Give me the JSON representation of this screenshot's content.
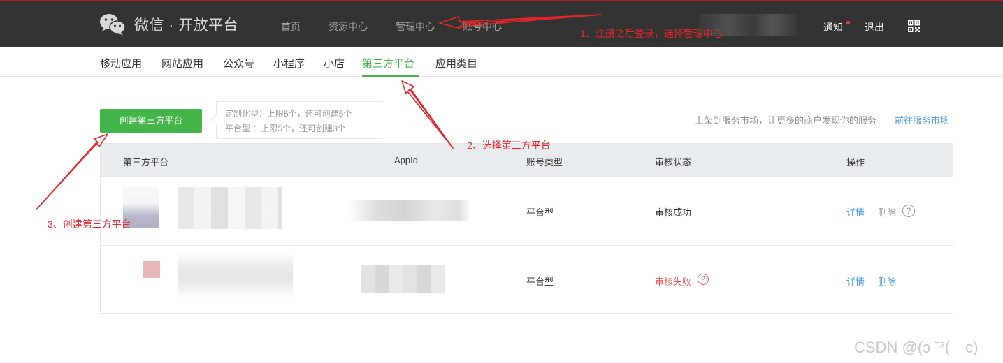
{
  "header": {
    "brand": "微信 · 开放平台",
    "nav": [
      "首页",
      "资源中心",
      "管理中心",
      "账号中心"
    ],
    "notify": "通知",
    "logout": "退出"
  },
  "subnav": {
    "items": [
      "移动应用",
      "网站应用",
      "公众号",
      "小程序",
      "小店",
      "第三方平台",
      "应用类目"
    ],
    "active": "第三方平台"
  },
  "toolbar": {
    "create_button": "创建第三方平台",
    "limit_line1": "定制化型：上限5个，还可创建5个",
    "limit_line2": "平台型 ：上限5个，还可创建3个",
    "market_text": "上架到服务市场，让更多的商户发现你的服务",
    "market_link": "前往服务市场"
  },
  "table": {
    "headers": [
      "第三方平台",
      "AppId",
      "账号类型",
      "审核状态",
      "操作"
    ],
    "rows": [
      {
        "type": "平台型",
        "status": "审核成功",
        "status_kind": "ok",
        "action_detail": "详情",
        "action_delete": "删除",
        "delete_disabled": true
      },
      {
        "type": "平台型",
        "status": "审核失败",
        "status_kind": "fail",
        "action_detail": "详情",
        "action_delete": "删除",
        "delete_disabled": false
      }
    ]
  },
  "annotations": {
    "step1": "1、注册之后登录，选择管理中心",
    "step2": "2、选择第三方平台",
    "step3": "3、创建第三方平台"
  },
  "watermark": "CSDN @(ɔ ˘³(　c)",
  "colors": {
    "topbar": "#333333",
    "accent_green": "#44b549",
    "link_blue": "#459ae9",
    "annotation_red": "#e8262a",
    "fail_red": "#e15f63"
  }
}
